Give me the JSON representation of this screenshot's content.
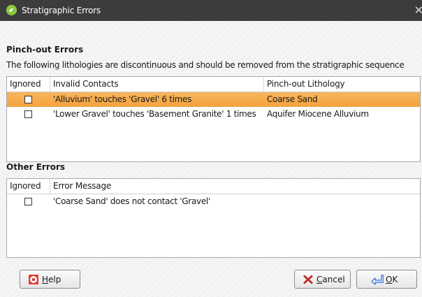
{
  "window": {
    "title": "Stratigraphic Errors",
    "app_icon": "leapfrog-logo-icon",
    "close_icon": "close-icon"
  },
  "pinch_out": {
    "heading": "Pinch-out Errors",
    "description": "The following lithologies are discontinuous and should be removed from the stratigraphic sequence",
    "columns": [
      "Ignored",
      "Invalid Contacts",
      "Pinch-out Lithology"
    ],
    "rows": [
      {
        "ignored": false,
        "contact": "'Alluvium' touches 'Gravel' 6 times",
        "lithology": "Coarse Sand",
        "selected": true
      },
      {
        "ignored": false,
        "contact": "'Lower Gravel' touches 'Basement Granite' 1 times",
        "lithology": "Aquifer Miocene Alluvium",
        "selected": false
      }
    ]
  },
  "other": {
    "heading": "Other Errors",
    "columns": [
      "Ignored",
      "Error Message"
    ],
    "rows": [
      {
        "ignored": false,
        "message": "'Coarse Sand' does not contact 'Gravel'"
      }
    ]
  },
  "buttons": {
    "help": {
      "label_first": "H",
      "label_rest": "elp",
      "icon": "lifebuoy-icon"
    },
    "cancel": {
      "label_first": "C",
      "label_rest": "ancel",
      "icon": "red-x-icon"
    },
    "ok": {
      "label_first": "O",
      "label_rest": "K",
      "icon": "return-arrow-icon"
    }
  },
  "colors": {
    "selection": "#f7a94a",
    "titlebar": "#3c3c3c",
    "app_icon": "#8cc63f"
  }
}
